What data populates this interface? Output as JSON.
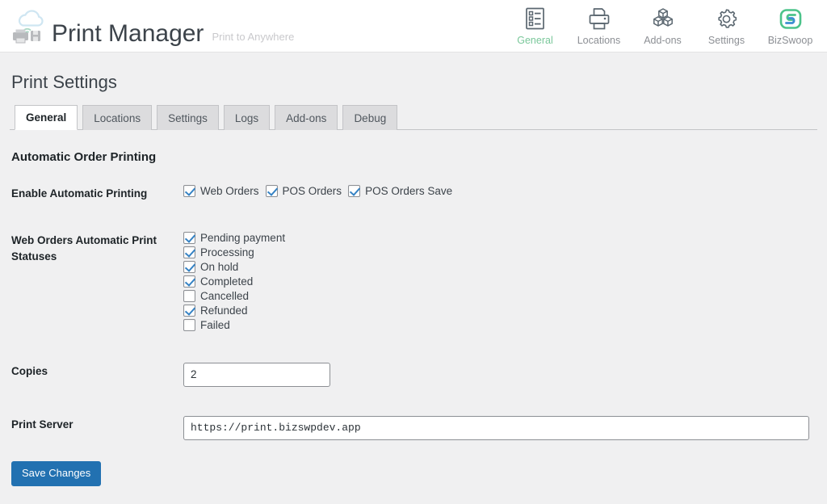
{
  "brand": {
    "title": "Print Manager",
    "tagline": "Print to Anywhere",
    "logo_icon": "cloud-printer-icon",
    "accent_green": "#7ac79a",
    "accent_blue": "#3582c4"
  },
  "header_nav": {
    "items": [
      {
        "label": "General",
        "icon": "list-document-icon",
        "active": true
      },
      {
        "label": "Locations",
        "icon": "printer-icon",
        "active": false
      },
      {
        "label": "Add-ons",
        "icon": "cubes-icon",
        "active": false
      },
      {
        "label": "Settings",
        "icon": "gear-icon",
        "active": false
      },
      {
        "label": "BizSwoop",
        "icon": "bizswoop-logo-icon",
        "active": false
      }
    ]
  },
  "page": {
    "title": "Print Settings",
    "section_title": "Automatic Order Printing"
  },
  "tabs": [
    {
      "label": "General",
      "active": true
    },
    {
      "label": "Locations",
      "active": false
    },
    {
      "label": "Settings",
      "active": false
    },
    {
      "label": "Logs",
      "active": false
    },
    {
      "label": "Add-ons",
      "active": false
    },
    {
      "label": "Debug",
      "active": false
    }
  ],
  "fields": {
    "enable_automatic_printing": {
      "label": "Enable Automatic Printing",
      "options": [
        {
          "label": "Web Orders",
          "checked": true
        },
        {
          "label": "POS Orders",
          "checked": true
        },
        {
          "label": "POS Orders Save",
          "checked": true
        }
      ]
    },
    "web_order_statuses": {
      "label": "Web Orders Automatic Print Statuses",
      "options": [
        {
          "label": "Pending payment",
          "checked": true
        },
        {
          "label": "Processing",
          "checked": true
        },
        {
          "label": "On hold",
          "checked": true
        },
        {
          "label": "Completed",
          "checked": true
        },
        {
          "label": "Cancelled",
          "checked": false
        },
        {
          "label": "Refunded",
          "checked": true
        },
        {
          "label": "Failed",
          "checked": false
        }
      ]
    },
    "copies": {
      "label": "Copies",
      "value": "2",
      "placeholder": ""
    },
    "print_server": {
      "label": "Print Server",
      "value": "https://print.bizswpdev.app",
      "placeholder": ""
    }
  },
  "actions": {
    "save_label": "Save Changes"
  }
}
